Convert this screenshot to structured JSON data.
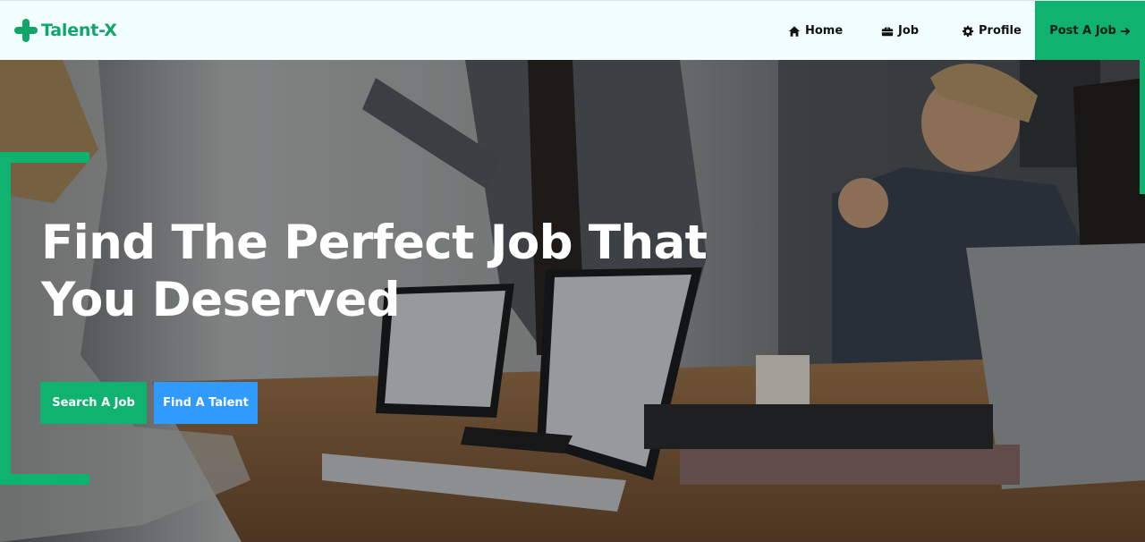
{
  "brand": {
    "name": "Talent-X",
    "color": "#10a66a"
  },
  "nav": {
    "items": [
      {
        "label": "Home",
        "icon": "home-icon"
      },
      {
        "label": "Job",
        "icon": "briefcase-icon"
      },
      {
        "label": "Profile",
        "icon": "gear-icon"
      }
    ],
    "cta": {
      "label": "Post A Job",
      "icon": "arrow-right-icon",
      "color": "#10b26f"
    }
  },
  "hero": {
    "title": "Find The Perfect Job That You Deserved",
    "buttons": {
      "search": {
        "label": "Search A Job",
        "color": "#10b26f"
      },
      "talent": {
        "label": "Find A Talent",
        "color": "#2f9bff"
      }
    },
    "background": "office-meeting-photo"
  }
}
